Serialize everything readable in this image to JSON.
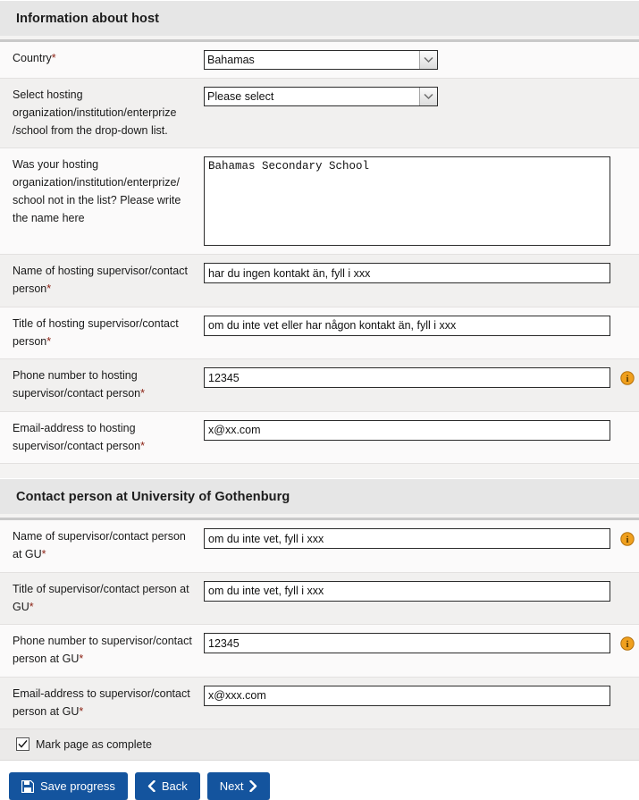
{
  "sections": [
    {
      "id": "host",
      "title": "Information about host",
      "rows": [
        {
          "label": "Country",
          "required": true,
          "control": "select",
          "value": "Bahamas",
          "info": false
        },
        {
          "label": "Select hosting organization/institution/enterprize /school from the drop-down list.",
          "required": false,
          "control": "select",
          "value": "Please select",
          "info": false
        },
        {
          "label": "Was your hosting organization/institution/enterprize/ school not in the list? Please write the name here",
          "required": false,
          "control": "textarea",
          "value": "Bahamas Secondary School",
          "info": false
        },
        {
          "label": "Name of hosting supervisor/contact person",
          "required": true,
          "control": "text",
          "value": "har du ingen kontakt än, fyll i xxx",
          "info": false
        },
        {
          "label": "Title of hosting supervisor/contact person",
          "required": true,
          "control": "text",
          "value": "om du inte vet eller har någon kontakt än, fyll i xxx",
          "info": false
        },
        {
          "label": "Phone number to hosting supervisor/contact person",
          "required": true,
          "control": "text",
          "value": "12345",
          "info": true
        },
        {
          "label": "Email-address to hosting supervisor/contact person",
          "required": true,
          "control": "text",
          "value": "x@xx.com",
          "info": false
        }
      ]
    },
    {
      "id": "gu",
      "title": "Contact person at University of Gothenburg",
      "rows": [
        {
          "label": "Name of supervisor/contact person at GU",
          "required": true,
          "control": "text",
          "value": "om du inte vet, fyll i xxx",
          "info": true
        },
        {
          "label": "Title of supervisor/contact person at GU",
          "required": true,
          "control": "text",
          "value": "om du inte vet, fyll i xxx",
          "info": false
        },
        {
          "label": "Phone number to supervisor/contact person at GU",
          "required": true,
          "control": "text",
          "value": "12345",
          "info": true
        },
        {
          "label": "Email-address to supervisor/contact person at GU",
          "required": true,
          "control": "text",
          "value": "x@xxx.com",
          "info": false
        }
      ]
    }
  ],
  "complete": {
    "label": "Mark page as complete",
    "checked": true
  },
  "buttons": {
    "save": {
      "label": "Save progress",
      "icon": "floppy-disk-icon"
    },
    "back": {
      "label": "Back",
      "icon": "chevron-left-icon"
    },
    "next": {
      "label": "Next",
      "icon": "chevron-right-icon"
    }
  },
  "colors": {
    "button_blue": "#14549e",
    "info_orange": "#f0a01e",
    "required_red": "#8a1f11",
    "header_gray": "#e6e6e6"
  }
}
